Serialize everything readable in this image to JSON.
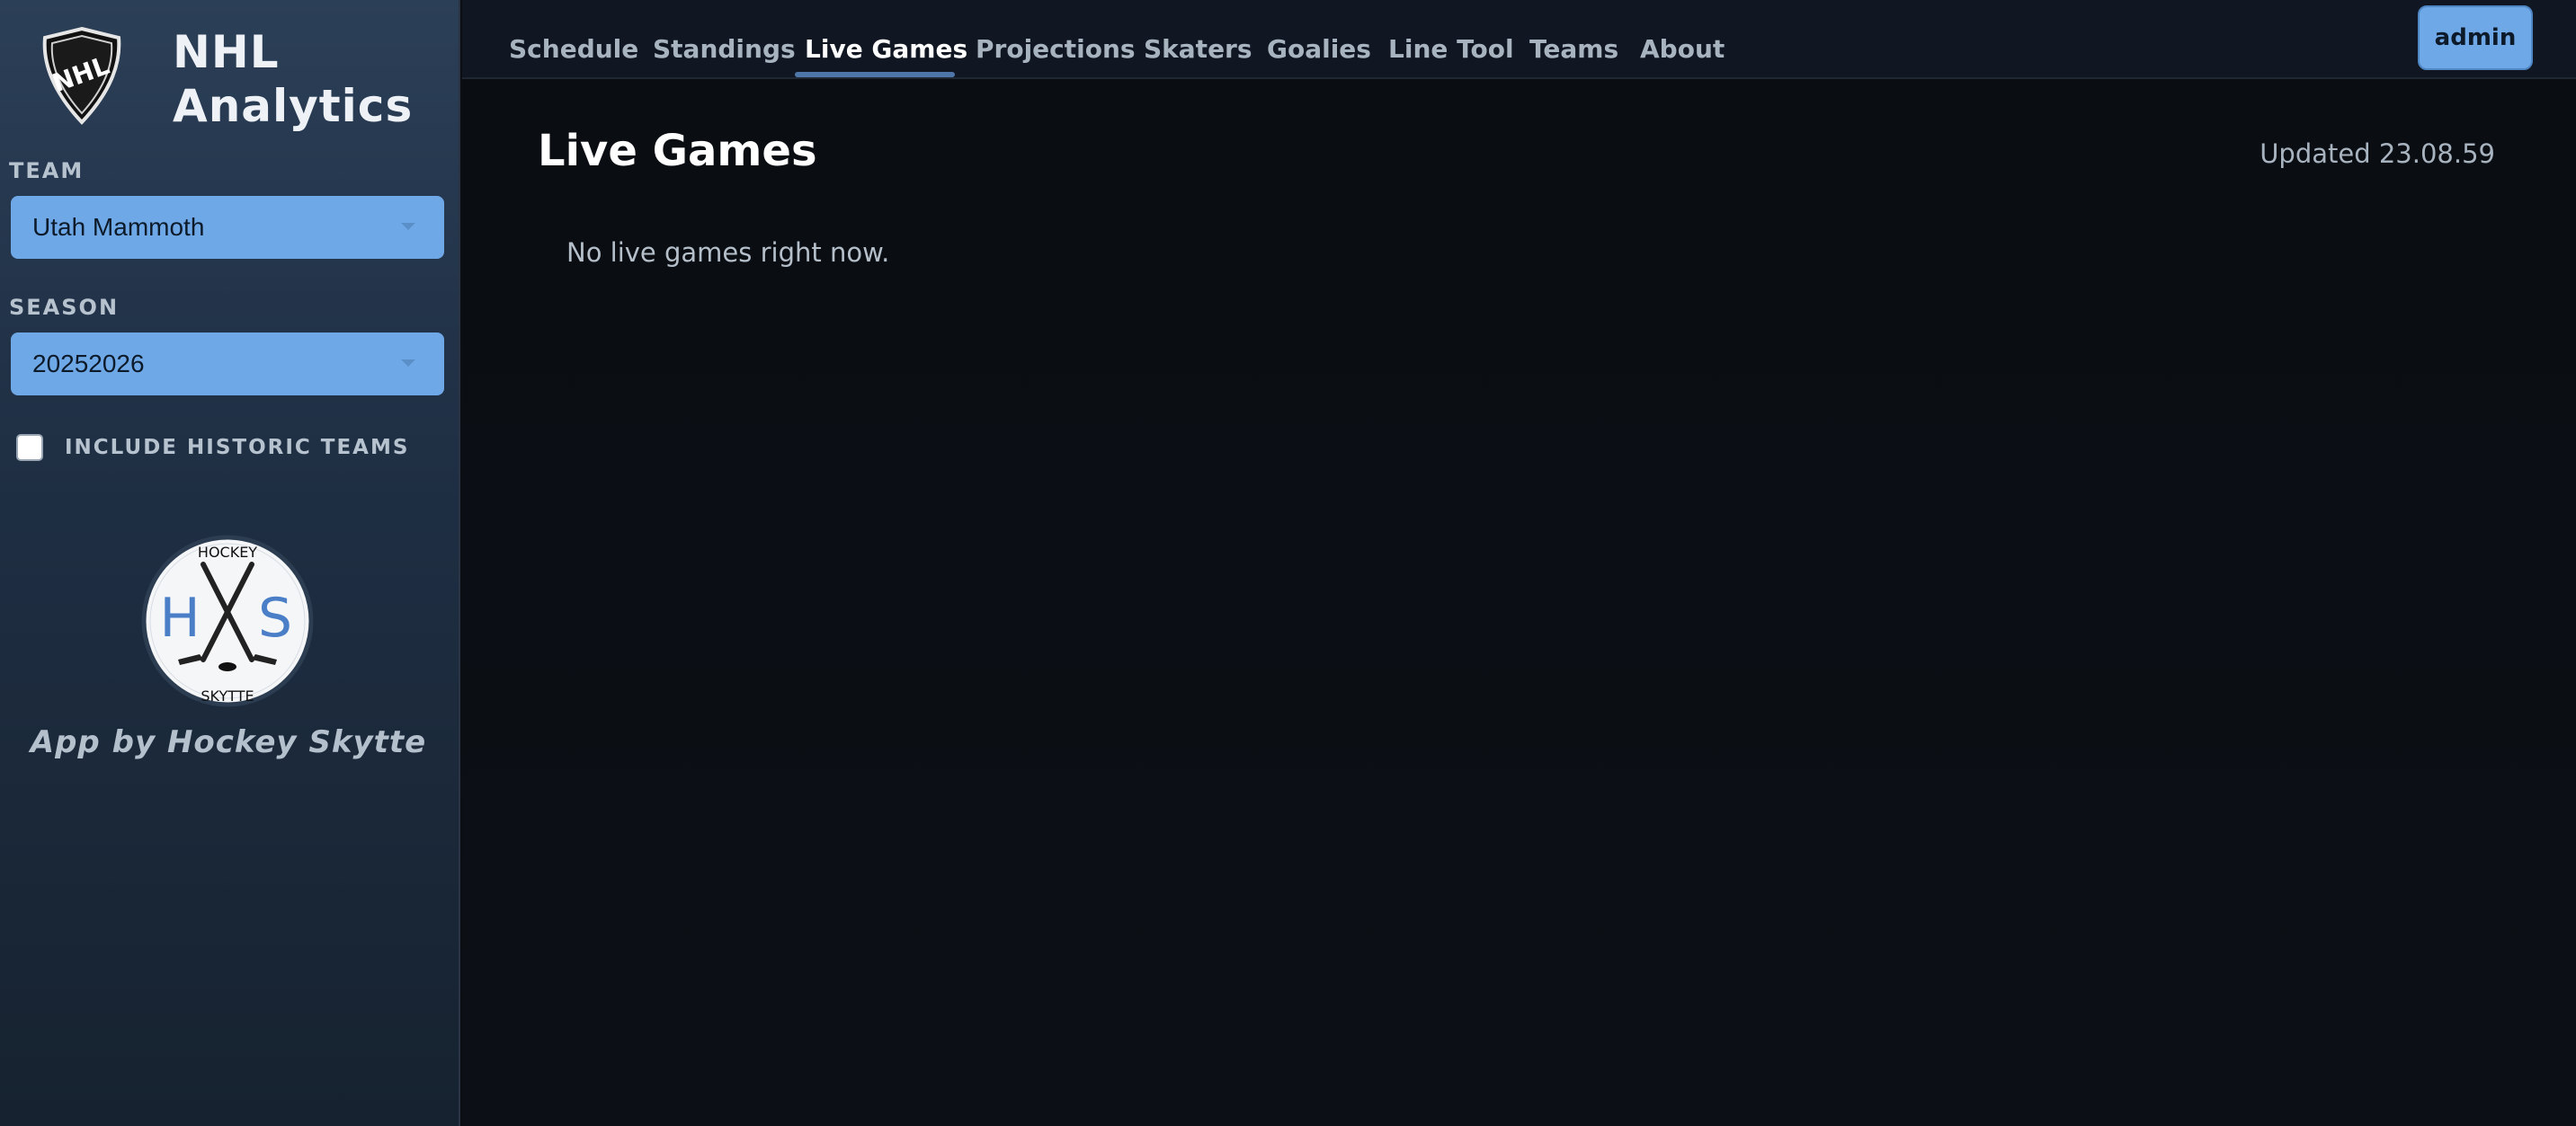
{
  "brand": {
    "title": "NHL\nAnalytics",
    "logo_icon": "nhl-shield-logo"
  },
  "sidebar": {
    "team_label": "TEAM",
    "team_value": "Utah Mammoth",
    "season_label": "SEASON",
    "season_value": "20252026",
    "historic_label": "INCLUDE HISTORIC TEAMS",
    "historic_checked": false,
    "hs_logo": {
      "top_text": "HOCKEY",
      "left_letter": "H",
      "right_letter": "S",
      "bottom_text": "SKYTTE"
    },
    "byline": "App by Hockey Skytte"
  },
  "nav": {
    "items": [
      {
        "label": "Schedule"
      },
      {
        "label": "Standings"
      },
      {
        "label": "Live Games",
        "active": true
      },
      {
        "label": "Projections"
      },
      {
        "label": "Skaters"
      },
      {
        "label": "Goalies"
      },
      {
        "label": "Line Tool"
      },
      {
        "label": "Teams"
      },
      {
        "label": "About"
      }
    ],
    "admin_label": "admin"
  },
  "main": {
    "title": "Live Games",
    "updated": "Updated 23.08.59",
    "empty_message": "No live games right now."
  },
  "colors": {
    "accent": "#6fa8e6",
    "nav_underline": "#4f76a9",
    "hs_blue": "#4a7fc8"
  }
}
